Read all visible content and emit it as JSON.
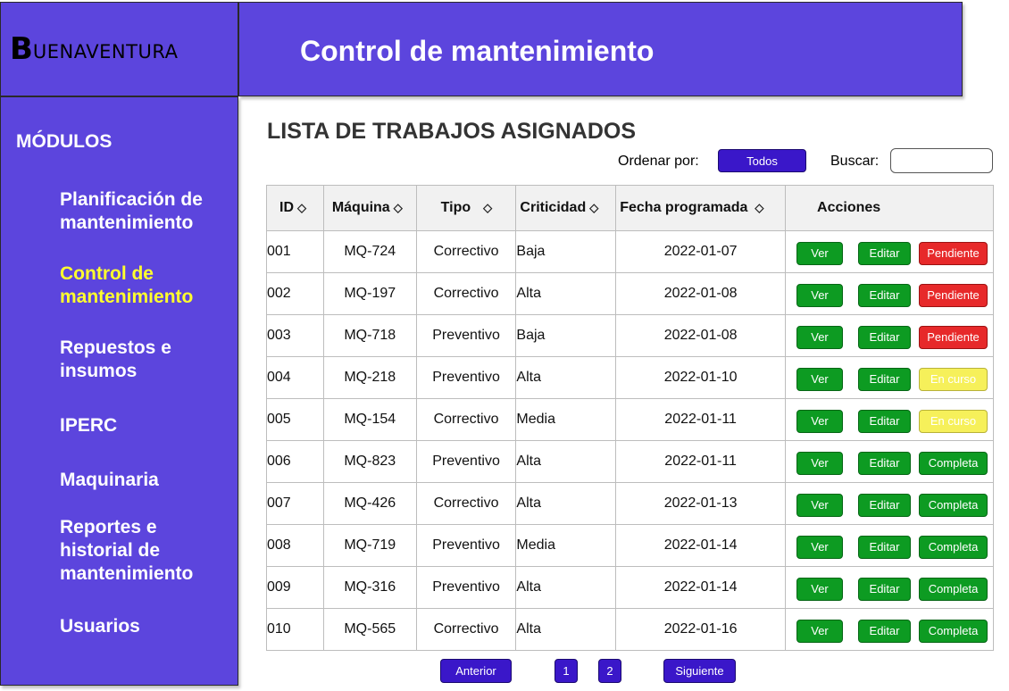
{
  "brand": {
    "logo_initial": "B",
    "logo_rest": "UENAVENTURA"
  },
  "header": {
    "title": "Control de mantenimiento"
  },
  "sidebar": {
    "title": "MÓDULOS",
    "items": [
      {
        "label": "Planificación de mantenimiento",
        "active": false
      },
      {
        "label": "Control de mantenimiento",
        "active": true
      },
      {
        "label": "Repuestos e insumos",
        "active": false
      },
      {
        "label": "IPERC",
        "active": false
      },
      {
        "label": "Maquinaria",
        "active": false
      },
      {
        "label": "Reportes e historial de mantenimiento",
        "active": false
      },
      {
        "label": "Usuarios",
        "active": false
      }
    ]
  },
  "main": {
    "title": "LISTA DE TRABAJOS ASIGNADOS",
    "sort_label": "Ordenar por:",
    "sort_button": "Todos",
    "search_label": "Buscar:",
    "search_value": "",
    "columns": [
      "ID",
      "Máquina",
      "Tipo",
      "Criticidad",
      "Fecha programada",
      "Acciones"
    ],
    "view_label": "Ver",
    "edit_label": "Editar",
    "rows": [
      {
        "id": "001",
        "machine": "MQ-724",
        "type": "Correctivo",
        "criticality": "Baja",
        "date": "2022-01-07",
        "status": "Pendiente",
        "status_kind": "pending"
      },
      {
        "id": "002",
        "machine": "MQ-197",
        "type": "Correctivo",
        "criticality": "Alta",
        "date": "2022-01-08",
        "status": "Pendiente",
        "status_kind": "pending"
      },
      {
        "id": "003",
        "machine": "MQ-718",
        "type": "Preventivo",
        "criticality": "Baja",
        "date": "2022-01-08",
        "status": "Pendiente",
        "status_kind": "pending"
      },
      {
        "id": "004",
        "machine": "MQ-218",
        "type": "Preventivo",
        "criticality": "Alta",
        "date": "2022-01-10",
        "status": "En curso",
        "status_kind": "inprogress"
      },
      {
        "id": "005",
        "machine": "MQ-154",
        "type": "Correctivo",
        "criticality": "Media",
        "date": "2022-01-11",
        "status": "En curso",
        "status_kind": "inprogress"
      },
      {
        "id": "006",
        "machine": "MQ-823",
        "type": "Preventivo",
        "criticality": "Alta",
        "date": "2022-01-11",
        "status": "Completa",
        "status_kind": "complete"
      },
      {
        "id": "007",
        "machine": "MQ-426",
        "type": "Correctivo",
        "criticality": "Alta",
        "date": "2022-01-13",
        "status": "Completa",
        "status_kind": "complete"
      },
      {
        "id": "008",
        "machine": "MQ-719",
        "type": "Preventivo",
        "criticality": "Media",
        "date": "2022-01-14",
        "status": "Completa",
        "status_kind": "complete"
      },
      {
        "id": "009",
        "machine": "MQ-316",
        "type": "Preventivo",
        "criticality": "Alta",
        "date": "2022-01-14",
        "status": "Completa",
        "status_kind": "complete"
      },
      {
        "id": "010",
        "machine": "MQ-565",
        "type": "Correctivo",
        "criticality": "Alta",
        "date": "2022-01-16",
        "status": "Completa",
        "status_kind": "complete"
      }
    ]
  },
  "pagination": {
    "prev": "Anterior",
    "pages": [
      "1",
      "2"
    ],
    "next": "Siguiente"
  },
  "colors": {
    "primary": "#5c45dd",
    "button_blue": "#3a17c9",
    "active_nav": "#ffff2e",
    "green": "#0d9b22",
    "red": "#e7292a",
    "yellow": "#f6f05a"
  }
}
